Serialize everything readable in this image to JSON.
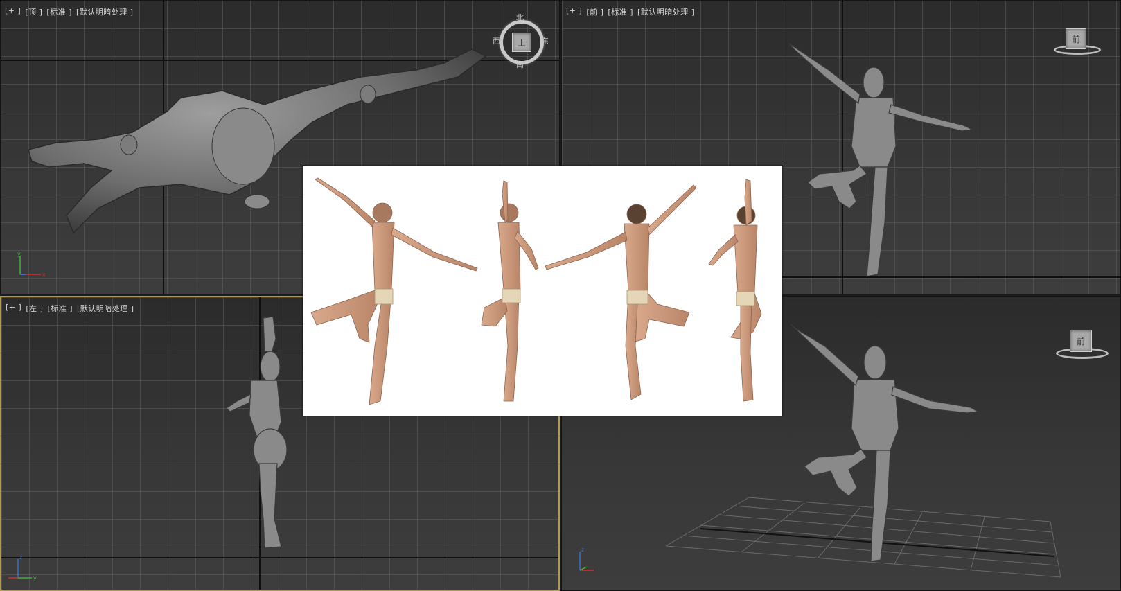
{
  "viewports": {
    "top": {
      "labels": [
        "+",
        "顶",
        "标准",
        "默认明暗处理"
      ],
      "cube_face": "上",
      "compass": [
        "北",
        "东",
        "南",
        "西"
      ]
    },
    "front": {
      "labels": [
        "+",
        "前",
        "标准",
        "默认明暗处理"
      ],
      "cube_face": "前"
    },
    "left": {
      "labels": [
        "+",
        "左",
        "标准",
        "默认明暗处理"
      ]
    },
    "perspective": {
      "cube_face": "前"
    }
  },
  "gizmo": {
    "x": "x",
    "y": "y",
    "z": "z"
  },
  "colors": {
    "active_border": "#b39a52",
    "axis_x": "#d03030",
    "axis_y": "#40b040",
    "axis_z": "#3a6fd0",
    "grid": "#5f5f5f",
    "background": "#2b2b2b"
  },
  "reference_image": {
    "poses": 4,
    "description_icon": "ballet-reference-photo"
  }
}
